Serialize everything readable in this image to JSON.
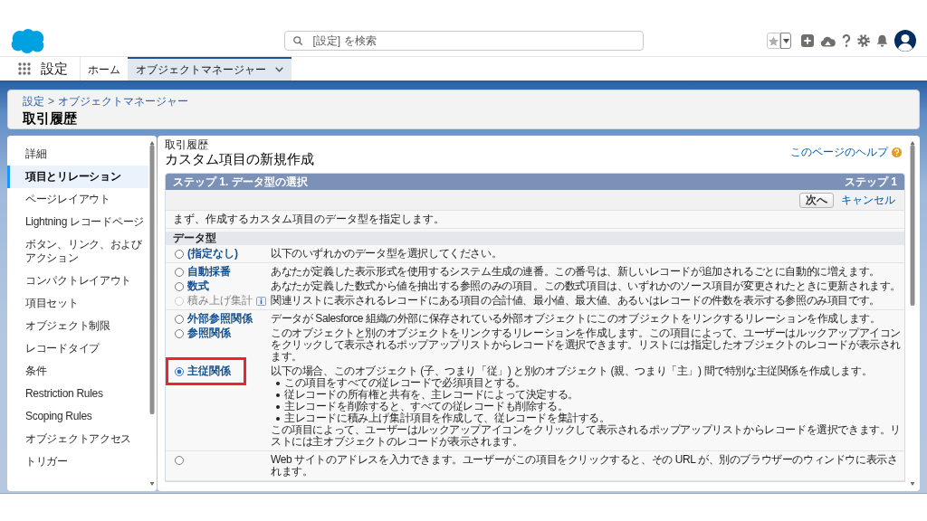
{
  "header": {
    "search": {
      "placeholder": "[設定] を検索"
    }
  },
  "nav": {
    "app_name": "設定",
    "tabs": [
      {
        "label": "ホーム",
        "selected": false,
        "dropdown": false
      },
      {
        "label": "オブジェクトマネージャー",
        "selected": true,
        "dropdown": true
      }
    ]
  },
  "page_header": {
    "breadcrumb": [
      "設定",
      "オブジェクトマネージャー"
    ],
    "separator": ">",
    "title": "取引履歴"
  },
  "sidebar": {
    "items": [
      {
        "label": "詳細",
        "selected": false
      },
      {
        "label": "項目とリレーション",
        "selected": true
      },
      {
        "label": "ページレイアウト",
        "selected": false
      },
      {
        "label": "Lightning レコードページ",
        "selected": false
      },
      {
        "label": "ボタン、リンク、およびアクション",
        "selected": false
      },
      {
        "label": "コンパクトレイアウト",
        "selected": false
      },
      {
        "label": "項目セット",
        "selected": false
      },
      {
        "label": "オブジェクト制限",
        "selected": false
      },
      {
        "label": "レコードタイプ",
        "selected": false
      },
      {
        "label": "条件",
        "selected": false
      },
      {
        "label": "Restriction Rules",
        "selected": false
      },
      {
        "label": "Scoping Rules",
        "selected": false
      },
      {
        "label": "オブジェクトアクセス",
        "selected": false
      },
      {
        "label": "トリガー",
        "selected": false
      }
    ]
  },
  "content": {
    "object_name": "取引履歴",
    "title": "カスタム項目の新規作成",
    "help_link": "このページのヘルプ",
    "step": {
      "title": "ステップ 1. データ型の選択",
      "counter": "ステップ 1",
      "actions": [
        {
          "label": "次へ",
          "kind": "button"
        },
        {
          "label": "キャンセル",
          "kind": "link"
        }
      ],
      "instruction": "まず、作成するカスタム項目のデータ型を指定します。",
      "section": "データ型",
      "groups": [
        {
          "items": [
            {
              "label": "(指定なし)",
              "selected": false,
              "disabled": false,
              "info": false,
              "highlighted": false,
              "description": "以下のいずれかのデータ型を選択してください。"
            }
          ]
        },
        {
          "items": [
            {
              "label": "自動採番",
              "selected": false,
              "disabled": false,
              "info": false,
              "highlighted": false,
              "description": "あなたが定義した表示形式を使用するシステム生成の連番。この番号は、新しいレコードが追加されるごとに自動的に増えます。"
            },
            {
              "label": "数式",
              "selected": false,
              "disabled": false,
              "info": false,
              "highlighted": false,
              "description": "あなたが定義した数式から値を抽出する参照のみの項目。この数式項目は、いずれかのソース項目が変更されたときに更新されます。"
            },
            {
              "label": "積み上げ集計",
              "selected": false,
              "disabled": true,
              "info": true,
              "highlighted": false,
              "description": "関連リストに表示されるレコードにある項目の合計値、最小値、最大値、あるいはレコードの件数を表示する参照のみ項目です。"
            }
          ]
        },
        {
          "items": [
            {
              "label": "外部参照関係",
              "selected": false,
              "disabled": false,
              "info": false,
              "highlighted": false,
              "description": "データが Salesforce 組織の外部に保存されている外部オブジェクトにこのオブジェクトをリンクするリレーションを作成します。"
            },
            {
              "label": "参照関係",
              "selected": false,
              "disabled": false,
              "info": false,
              "highlighted": false,
              "description": "このオブジェクトと別のオブジェクトをリンクするリレーションを作成します。この項目によって、ユーザーはルックアップアイコンをクリックして表示されるポップアップリストからレコードを選択できます。リストには指定したオブジェクトのレコードが表示されます。"
            },
            {
              "label": "主従関係",
              "selected": true,
              "disabled": false,
              "info": false,
              "highlighted": true,
              "description": "以下の場合、このオブジェクト (子、つまり「従」) と別のオブジェクト (親、つまり「主」) 間で特別な主従関係を作成します。",
              "bullets": [
                "この項目をすべての従レコードで必須項目とする。",
                "従レコードの所有権と共有を、主レコードによって決定する。",
                "主レコードを削除すると、すべての従レコードも削除する。",
                "主レコードに積み上げ集計項目を作成して、従レコードを集計する。"
              ],
              "note": "この項目によって、ユーザーはルックアップアイコンをクリックして表示されるポップアップリストからレコードを選択できます。リストには主オブジェクトのレコードが表示されます。"
            }
          ]
        },
        {
          "items": [
            {
              "selected": false,
              "disabled": false,
              "info": false,
              "highlighted": false,
              "description": "Web サイトのアドレスを入力できます。ユーザーがこの項目をクリックすると、その URL が、別のブラウザーのウィンドウに表示されます。"
            }
          ]
        }
      ]
    }
  }
}
